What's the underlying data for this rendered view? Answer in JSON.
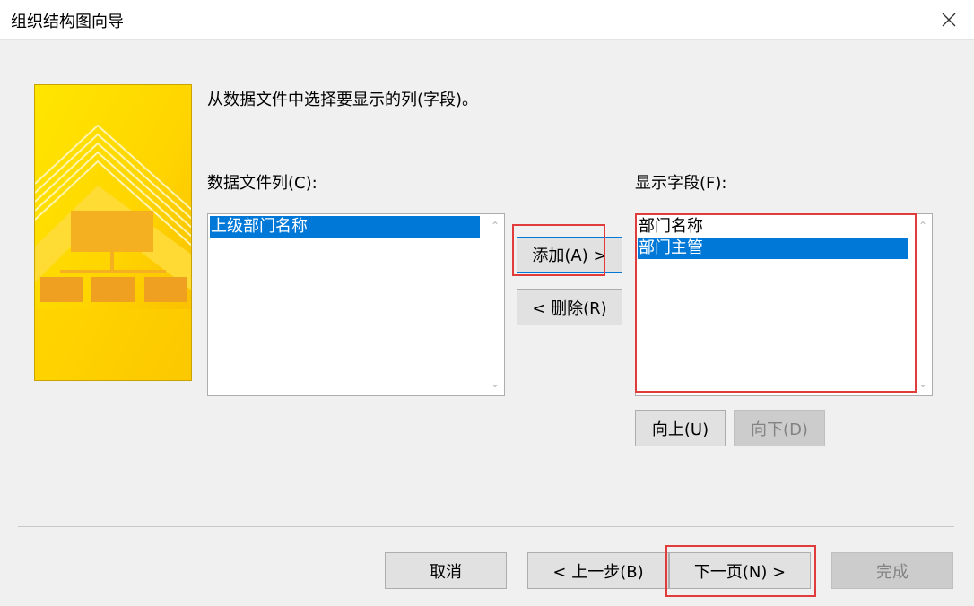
{
  "window": {
    "title": "组织结构图向导"
  },
  "instruction": "从数据文件中选择要显示的列(字段)。",
  "source": {
    "label": "数据文件列(C):",
    "items": [
      {
        "text": "上级部门名称",
        "selected": true
      }
    ]
  },
  "target": {
    "label": "显示字段(F):",
    "items": [
      {
        "text": "部门名称",
        "selected": false
      },
      {
        "text": "部门主管",
        "selected": true
      }
    ]
  },
  "buttons": {
    "add": "添加(A) >",
    "remove": "< 删除(R)",
    "up": "向上(U)",
    "down": "向下(D)",
    "cancel": "取消",
    "back": "< 上一步(B)",
    "next": "下一页(N) >",
    "finish": "完成"
  },
  "colors": {
    "selection": "#0078d7",
    "highlight": "#e03c3c",
    "banner": "#ffd400"
  }
}
